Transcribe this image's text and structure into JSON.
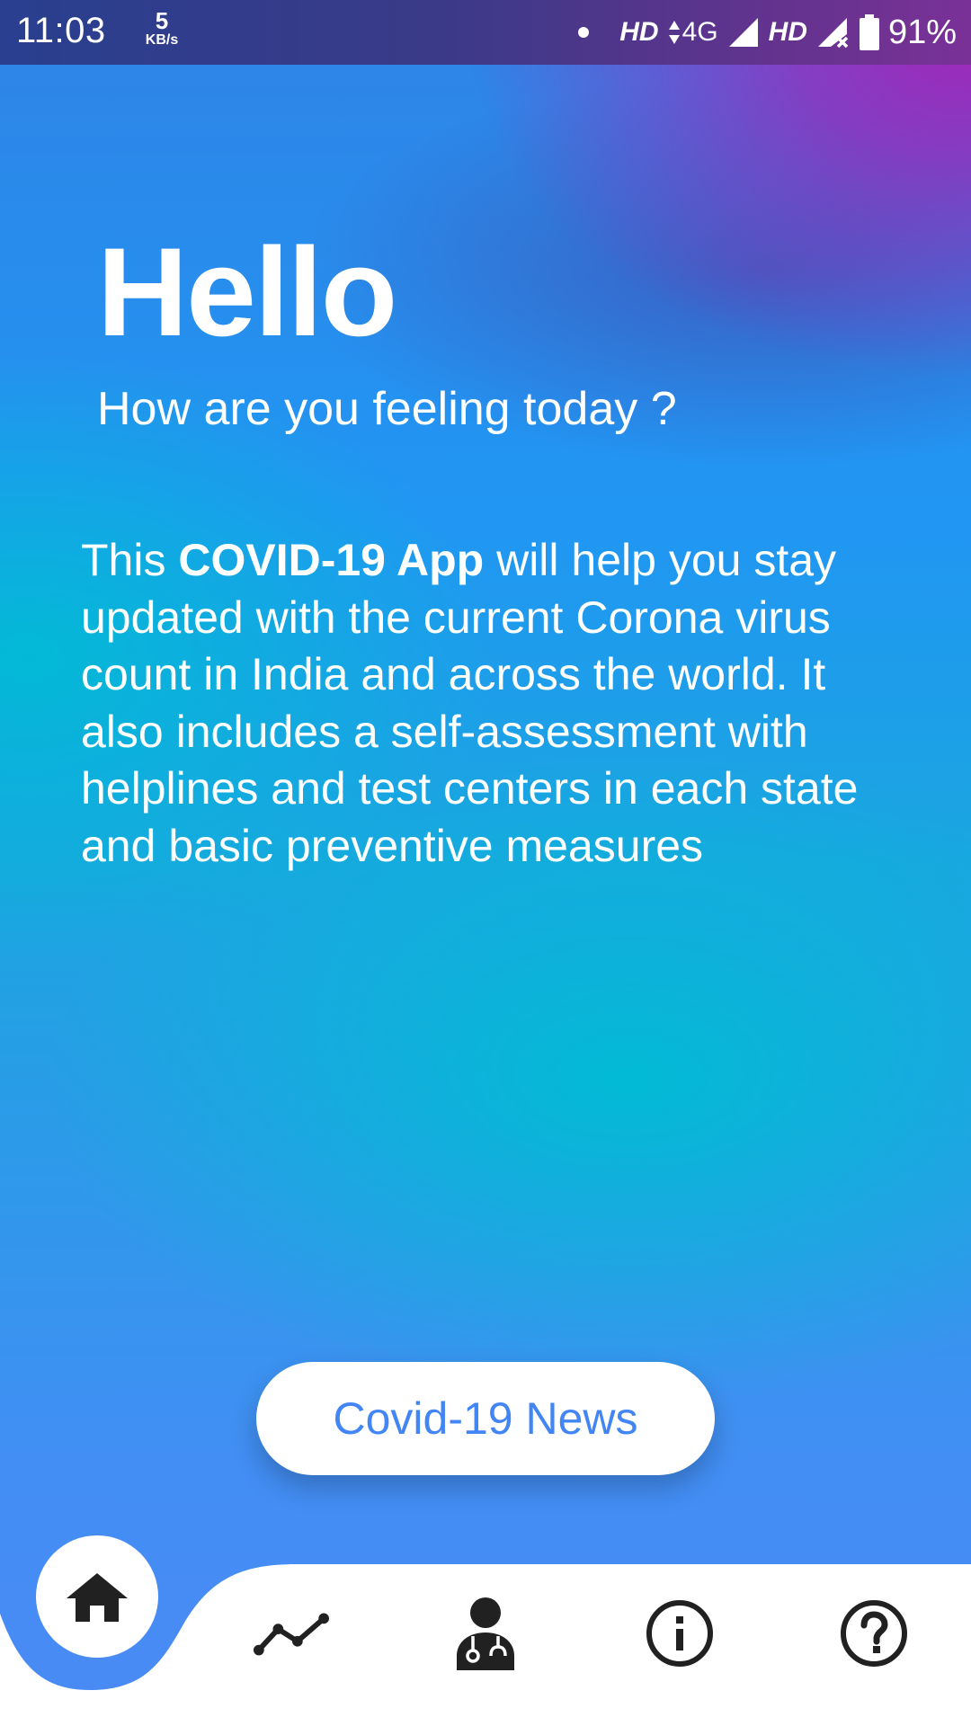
{
  "status_bar": {
    "time": "11:03",
    "net_speed_value": "5",
    "net_speed_unit": "KB/s",
    "hd1": "HD",
    "network": "4G",
    "hd2": "HD",
    "battery_percent": "91%"
  },
  "main": {
    "greeting": "Hello",
    "subtitle": "How are you feeling today ?",
    "description_prefix": "This ",
    "description_app_name": "COVID-19 App",
    "description_rest": " will help you stay updated with the current Corona virus count in India and across the world. It also includes a self-assessment with helplines and test centers in each state and basic preventive measures",
    "news_button_label": "Covid-19 News"
  },
  "bottom_nav": {
    "items": [
      {
        "icon": "home-icon",
        "active": true
      },
      {
        "icon": "stats-trend-icon",
        "active": false
      },
      {
        "icon": "doctor-icon",
        "active": false
      },
      {
        "icon": "info-icon",
        "active": false
      },
      {
        "icon": "help-icon",
        "active": false
      }
    ]
  },
  "colors": {
    "accent_blue": "#4285f4",
    "nav_wave": "#4a8af4",
    "icon_dark": "#212121",
    "purple": "#a126b8",
    "cyan": "#00bcd4"
  }
}
